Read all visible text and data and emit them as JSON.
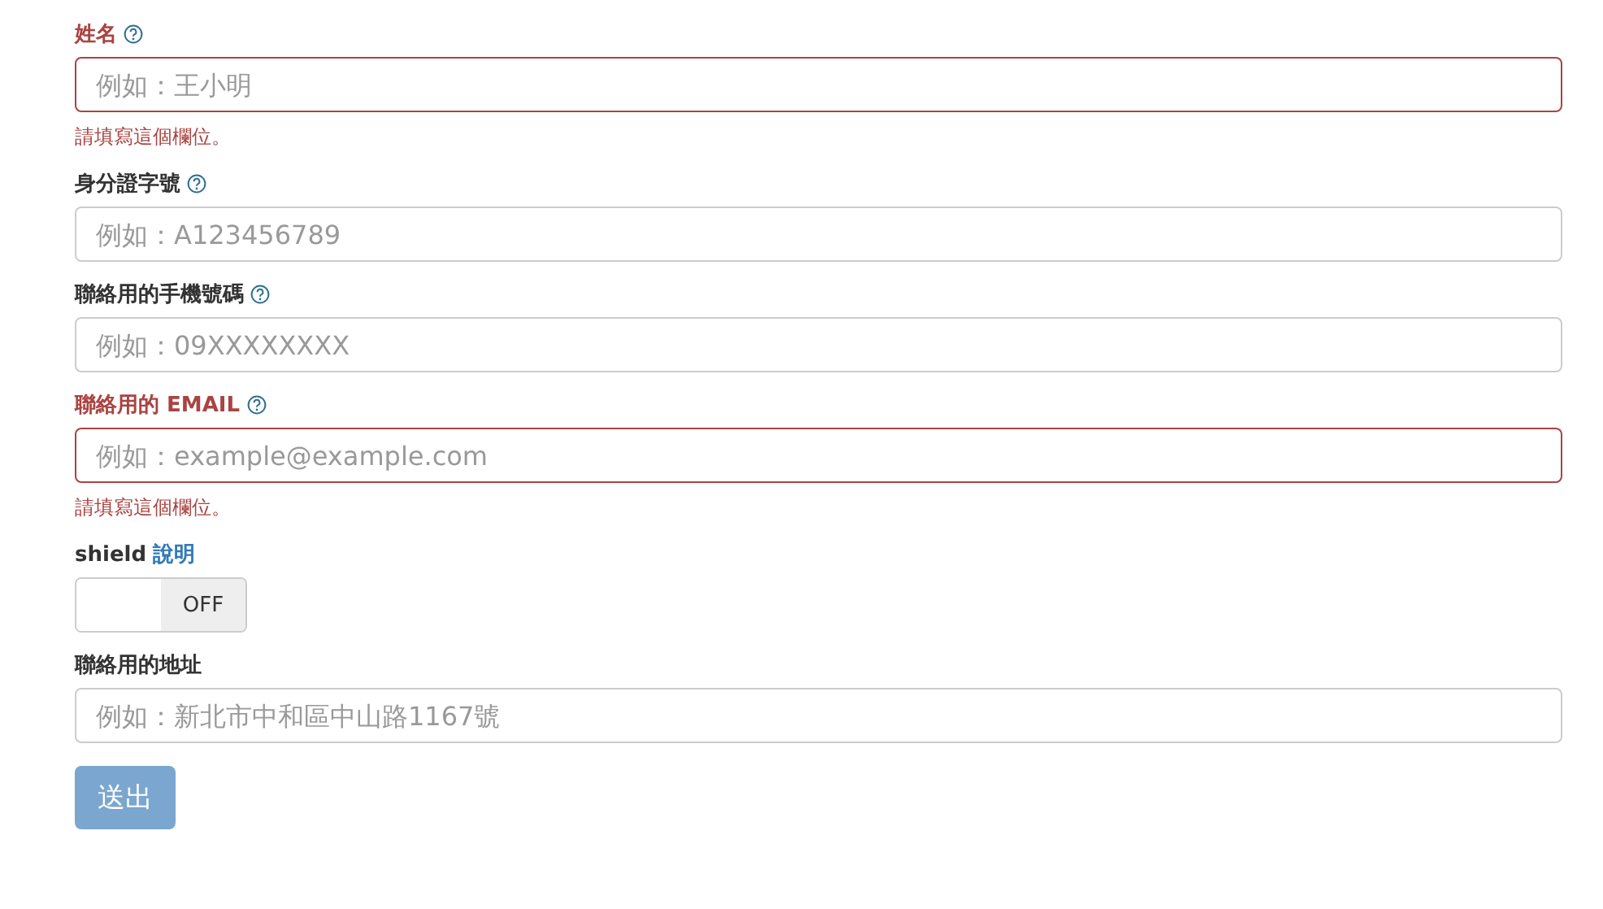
{
  "fields": [
    {
      "kind": "text",
      "label": "姓名",
      "help": true,
      "placeholder": "例如：王小明",
      "invalid": true,
      "error": "請填寫這個欄位。"
    },
    {
      "kind": "text",
      "label": "身分證字號",
      "help": true,
      "placeholder": "例如：A123456789",
      "invalid": false
    },
    {
      "kind": "text",
      "label": "聯絡用的手機號碼",
      "help": true,
      "placeholder": "例如：09XXXXXXXX",
      "invalid": false
    },
    {
      "kind": "text",
      "label": "聯絡用的 EMAIL",
      "help": true,
      "placeholder": "例如：example@example.com",
      "invalid": true,
      "error": "請填寫這個欄位。"
    },
    {
      "kind": "toggle",
      "label": "shield",
      "link": "說明",
      "state": "OFF",
      "on": false
    },
    {
      "kind": "text",
      "label": "聯絡用的地址",
      "help": false,
      "placeholder": "例如：新北市中和區中山路1167號",
      "invalid": false
    }
  ],
  "submit": {
    "label": "送出",
    "disabled": true
  }
}
